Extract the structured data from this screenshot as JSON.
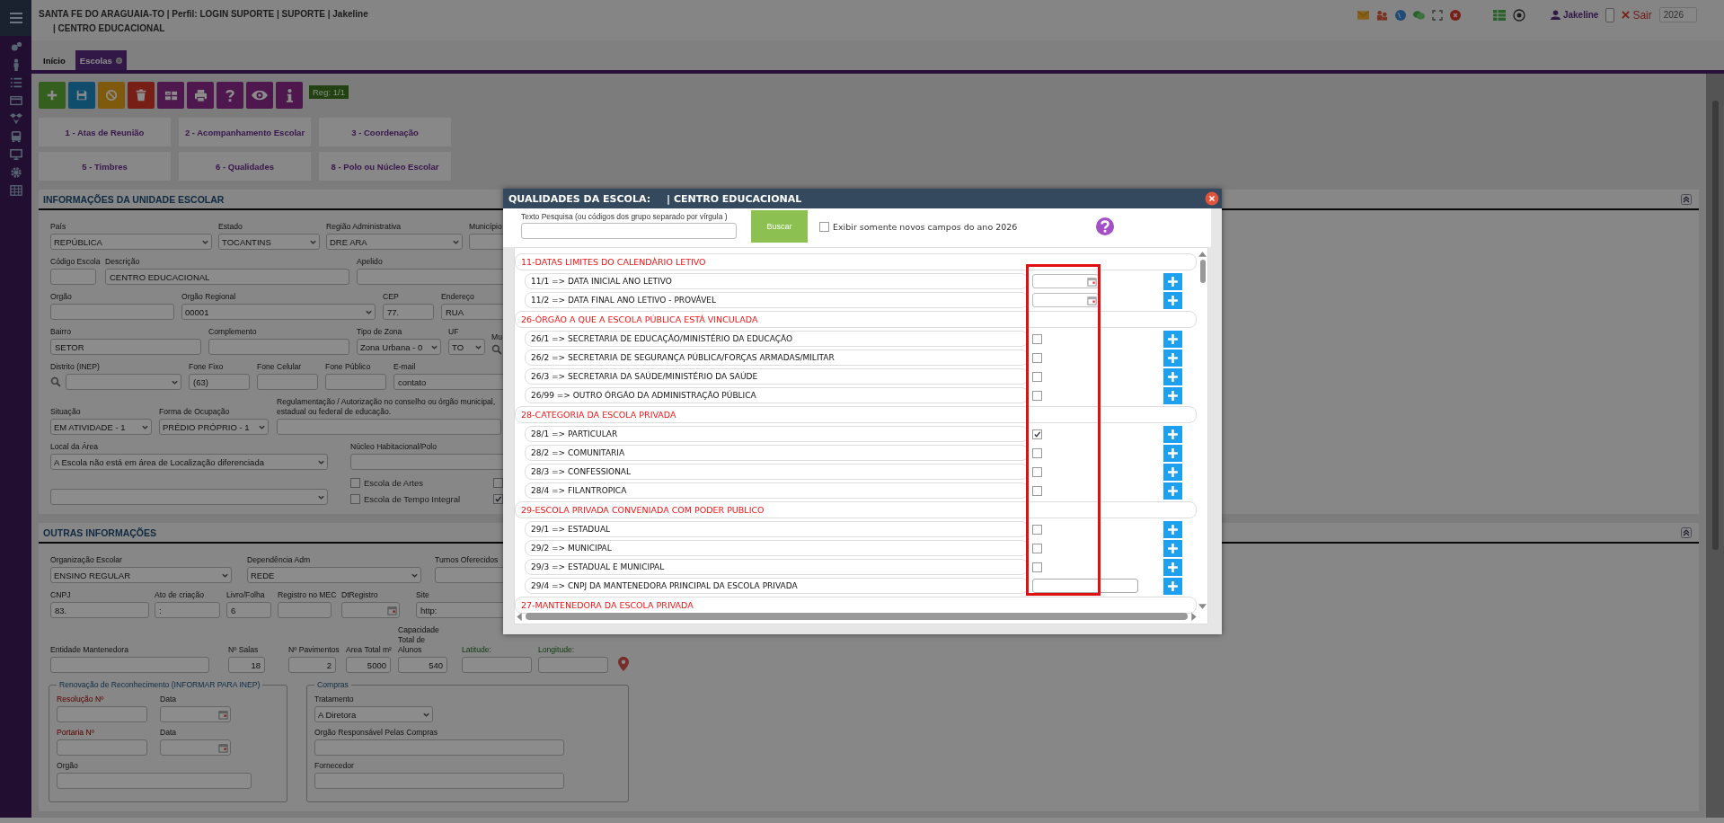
{
  "header": {
    "title": "SANTA FE DO ARAGUAIA-TO | Perfil: LOGIN SUPORTE | SUPORTE | Jakeline",
    "subtitle": "| CENTRO EDUCACIONAL",
    "user": "Jakeline",
    "logout": "Sair",
    "year": "2026"
  },
  "tabs": [
    {
      "label": "Início",
      "selected": false,
      "closable": false
    },
    {
      "label": "Escolas",
      "selected": true,
      "closable": true
    }
  ],
  "toolbar": {
    "buttons": [
      {
        "kind": "add"
      },
      {
        "kind": "save"
      },
      {
        "kind": "cancel"
      },
      {
        "kind": "delete"
      },
      {
        "kind": "grid"
      },
      {
        "kind": "print"
      },
      {
        "kind": "help"
      },
      {
        "kind": "view"
      },
      {
        "kind": "info"
      }
    ],
    "record": "Reg: 1/1"
  },
  "shortcuts": [
    "1 - Atas de Reunião",
    "2 - Acompanhamento Escolar",
    "3 - Coordenação",
    "5 - Timbres",
    "6 - Qualidades",
    "8 - Polo ou Núcleo Escolar"
  ],
  "sections": [
    {
      "title": "INFORMAÇÕES DA UNIDADE ESCOLAR",
      "rows": [
        {
          "fields": [
            {
              "label": "País",
              "kind": "select",
              "value": "REPÚBLICA"
            },
            {
              "label": "Estado",
              "kind": "select",
              "value": "TOCANTINS"
            },
            {
              "label": "Região Administrativa",
              "kind": "select",
              "value": "DRE ARA"
            },
            {
              "label": "Município",
              "kind": "text"
            }
          ]
        },
        {
          "fields": [
            {
              "label": "Código Escola",
              "kind": "text"
            },
            {
              "label": "Descrição",
              "kind": "text",
              "value": "CENTRO EDUCACIONAL"
            },
            {
              "label": "Apelido",
              "kind": "text"
            }
          ]
        },
        {
          "fields": [
            {
              "label": "Orgão",
              "kind": "text"
            },
            {
              "label": "Orgão Regional",
              "kind": "select",
              "value": "00001"
            },
            {
              "label": "CEP",
              "kind": "text",
              "value": "77."
            },
            {
              "label": "Endereço",
              "kind": "text",
              "value": "RUA"
            }
          ]
        },
        {
          "fields": [
            {
              "label": "Bairro",
              "kind": "text",
              "value": "SETOR"
            },
            {
              "label": "Complemento",
              "kind": "text"
            },
            {
              "label": "Tipo de Zona",
              "kind": "select",
              "value": "Zona Urbana - 0"
            },
            {
              "label": "UF",
              "kind": "select",
              "value": "TO"
            },
            {
              "label": "Mu",
              "kind": "lookup"
            }
          ]
        },
        {
          "fields": [
            {
              "label": "Distrito (INEP)",
              "kind": "search-select"
            },
            {
              "label": "Fone Fixo",
              "kind": "text",
              "value": "(63)"
            },
            {
              "label": "Fone Celular",
              "kind": "text"
            },
            {
              "label": "Fone Público",
              "kind": "text"
            },
            {
              "label": "E-mail",
              "kind": "text",
              "value": "contato"
            }
          ]
        },
        {
          "fields": [
            {
              "label": "Situação",
              "kind": "select",
              "value": "EM ATIVIDADE - 1"
            },
            {
              "label": "Forma de Ocupação",
              "kind": "select",
              "value": "PRÉDIO PRÓPRIO - 1"
            },
            {
              "label": "Regulamentação / Autorização no conselho ou órgão municipal, estadual ou federal de educação.",
              "kind": "text"
            }
          ]
        },
        {
          "fields": [
            {
              "label": "Local da Área",
              "kind": "select",
              "value": "A Escola não está em área de Localização diferenciada"
            },
            {
              "label": "Núcleo Habitacional/Polo",
              "kind": "text"
            }
          ]
        },
        {
          "fields": [
            {
              "kind": "select"
            },
            {
              "kind": "checks",
              "items": [
                {
                  "label": "Escola de Artes",
                  "checked": false
                },
                {
                  "label": "Escola de Tempo Integral",
                  "checked": false
                }
              ]
            },
            {
              "kind": "checks",
              "items": [
                {
                  "checked": false
                },
                {
                  "checked": true
                }
              ]
            }
          ]
        }
      ]
    },
    {
      "title": "OUTRAS INFORMAÇÕES",
      "rows": [
        {
          "fields": [
            {
              "label": "Organização Escolar",
              "kind": "select",
              "value": "ENSINO REGULAR"
            },
            {
              "label": "Dependência Adm",
              "kind": "select",
              "value": "REDE"
            },
            {
              "label": "Turnos Oferecidos",
              "kind": "text"
            }
          ]
        },
        {
          "fields": [
            {
              "label": "CNPJ",
              "kind": "text",
              "value": "83."
            },
            {
              "label": "Ato de criação",
              "kind": "text",
              "value": ":"
            },
            {
              "label": "Livro/Folha",
              "kind": "text",
              "value": "6"
            },
            {
              "label": "Registro no MEC",
              "kind": "text"
            },
            {
              "label": "DtRegistro",
              "kind": "date"
            },
            {
              "label": "Site",
              "kind": "text",
              "value": "http:"
            }
          ]
        },
        {
          "fields": [
            {
              "label": "Entidade Mantenedora",
              "kind": "text"
            },
            {
              "label": "Nº Salas",
              "kind": "number",
              "value": "18"
            },
            {
              "label": "Nº Pavimentos",
              "kind": "number",
              "value": "2"
            },
            {
              "label": "Area Total m²",
              "kind": "number",
              "value": "5000"
            },
            {
              "label": "Capacidade Total de Alunos",
              "kind": "number",
              "value": "540"
            },
            {
              "label": "Latitude:",
              "kind": "text",
              "location": true
            },
            {
              "label": "Longitude:",
              "kind": "text",
              "location": true
            },
            {
              "kind": "pin"
            }
          ]
        }
      ],
      "fieldsets": [
        {
          "legend": "Renovação de Reconhecimento (INFORMAR PARA INEP)",
          "rows": [
            {
              "fields": [
                {
                  "label": "Resolução Nº",
                  "kind": "text",
                  "required": true
                },
                {
                  "label": "Data",
                  "kind": "date"
                }
              ]
            },
            {
              "fields": [
                {
                  "label": "Portaria Nº",
                  "kind": "text",
                  "required": true
                },
                {
                  "label": "Data",
                  "kind": "date"
                }
              ]
            },
            {
              "fields": [
                {
                  "label": "Orgão",
                  "kind": "text"
                }
              ]
            }
          ]
        },
        {
          "legend": "Compras",
          "rows": [
            {
              "fields": [
                {
                  "label": "Tratamento",
                  "kind": "select",
                  "value": "A Diretora"
                }
              ]
            },
            {
              "fields": [
                {
                  "label": "Orgão Responsável Pelas Compras",
                  "kind": "text"
                }
              ]
            },
            {
              "fields": [
                {
                  "label": "Fornecedor",
                  "kind": "text"
                }
              ]
            }
          ]
        }
      ]
    }
  ],
  "dialog": {
    "title": "QUALIDADES DA ESCOLA:",
    "subtitle": "| CENTRO EDUCACIONAL",
    "search_label": "Texto Pesquisa (ou códigos dos grupo separado por vírgula )",
    "search_button": "Buscar",
    "filter": {
      "label": "Exibir somente novos campos do ano 2026",
      "checked": false
    },
    "groups": [
      {
        "title": "11-DATAS LIMITES DO CALENDÀRIO LETIVO",
        "items": [
          {
            "label": "11/1 => DATA INICIAL ANO LETIVO",
            "kind": "date"
          },
          {
            "label": "11/2 => DATA FINAL ANO LETIVO - PROVÁVEL",
            "kind": "date"
          }
        ]
      },
      {
        "title": "26-ÓRGÃO A QUE A ESCOLA PÚBLICA ESTÁ VINCULADA",
        "items": [
          {
            "label": "26/1 => SECRETARIA DE EDUCAÇÃO/MINISTÉRIO DA EDUCAÇÃO",
            "kind": "checkbox",
            "checked": false
          },
          {
            "label": "26/2 => SECRETARIA DE SEGURANÇA PÚBLICA/FORÇAS ARMADAS/MILITAR",
            "kind": "checkbox",
            "checked": false
          },
          {
            "label": "26/3 => SECRETARIA DA SAÚDE/MINISTÉRIO DA SAÚDE",
            "kind": "checkbox",
            "checked": false
          },
          {
            "label": "26/99 => OUTRO ÓRGÃO DA ADMINISTRAÇÃO PÚBLICA",
            "kind": "checkbox",
            "checked": false
          }
        ]
      },
      {
        "title": "28-CATEGORIA DA ESCOLA PRIVADA",
        "items": [
          {
            "label": "28/1 => PARTICULAR",
            "kind": "checkbox",
            "checked": true
          },
          {
            "label": "28/2 => COMUNITARIA",
            "kind": "checkbox",
            "checked": false
          },
          {
            "label": "28/3 => CONFESSIONAL",
            "kind": "checkbox",
            "checked": false
          },
          {
            "label": "28/4 => FILANTROPICA",
            "kind": "checkbox",
            "checked": false
          }
        ]
      },
      {
        "title": "29-ESCOLA PRIVADA CONVENIADA COM PODER PUBLICO",
        "items": [
          {
            "label": "29/1 => ESTADUAL",
            "kind": "checkbox",
            "checked": false
          },
          {
            "label": "29/2 => MUNICIPAL",
            "kind": "checkbox",
            "checked": false
          },
          {
            "label": "29/3 => ESTADUAL E MUNICIPAL",
            "kind": "checkbox",
            "checked": false
          },
          {
            "label": "29/4 => CNPJ DA MANTENEDORA PRINCIPAL DA ESCOLA PRIVADA",
            "kind": "text"
          }
        ]
      },
      {
        "title": "27-MANTENEDORA DA ESCOLA PRIVADA"
      }
    ]
  }
}
